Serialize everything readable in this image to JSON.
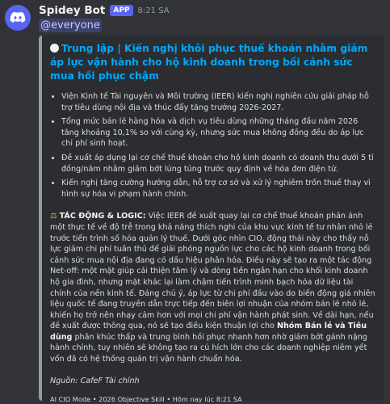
{
  "bot": {
    "name": "Spidey Bot",
    "badge": "APP",
    "timestamp": "8:21 SA",
    "mention": "@everyone"
  },
  "embed": {
    "accent_color": "#949ba4",
    "title": "Trung lập | Kiến nghị khôi phục thuế khoán nhằm giảm áp lực vận hành cho hộ kinh doanh trong bối cảnh sức mua hồi phục chậm",
    "bullets": [
      "Viện Kinh tế Tài nguyên và Môi trường (IEER) kiến nghị nghiên cứu giải pháp hỗ trợ tiêu dùng nội địa và thúc đẩy tăng trưởng 2026-2027.",
      "Tổng mức bán lẻ hàng hóa và dịch vụ tiêu dùng những tháng đầu năm 2026 tăng khoảng 10,1% so với cùng kỳ, nhưng sức mua không đồng đều do áp lực chi phí sinh hoạt.",
      "Đề xuất áp dụng lại cơ chế thuế khoán cho hộ kinh doanh có doanh thu dưới 5 tỉ đồng/năm nhằm giảm bớt lúng túng trước quy định về hóa đơn điện tử.",
      "Kiến nghị tăng cường hướng dẫn, hỗ trợ cơ sở và xử lý nghiêm trốn thuế thay vì hình sự hóa vi phạm hành chính."
    ],
    "impact_label": "TÁC ĐỘNG & LOGIC:",
    "impact_text_1": " Việc IEER đề xuất quay lại cơ chế thuế khoán phản ánh một thực tế về độ trễ trong khả năng thích nghi của khu vực kinh tế tư nhân nhỏ lẻ trước tiến trình số hóa quản lý thuế. Dưới góc nhìn CIO, động thái này cho thấy nỗ lực giảm chi phí tuân thủ để giải phóng nguồn lực cho các hộ kinh doanh trong bối cảnh sức mua nội địa đang có dấu hiệu phân hóa. Điều này sẽ tạo ra một tác động Net-off: một mặt giúp cải thiện tâm lý và dòng tiền ngắn hạn cho khối kinh doanh hộ gia đình, nhưng mặt khác lại làm chậm tiến trình minh bạch hóa dữ liệu tài chính của nền kinh tế. Đáng chú ý, áp lực từ chi phí đầu vào do biến động giá nhiên liệu quốc tế đang truyền dẫn trực tiếp đến biên lợi nhuận của nhóm bán lẻ nhỏ lẻ, khiến họ trở nên nhạy cảm hơn với mọi chi phí vận hành phát sinh. Về dài hạn, nếu đề xuất được thông qua, nó sẽ tạo điều kiện thuận lợi cho ",
    "impact_bold": "Nhóm Bán lẻ và Tiêu dùng",
    "impact_text_2": " phân khúc thấp và trung bình hồi phục nhanh hơn nhờ giảm bớt gánh nặng hành chính, tuy nhiên sẽ không tạo ra cú hích lớn cho các doanh nghiệp niêm yết vốn đã có hệ thống quản trị vận hành chuẩn hóa.",
    "source": "Nguồn: CafeF Tài chính",
    "footer": "AI CIO Mode • 2026 Objective Skill • Hôm nay lúc 8:21 SA"
  },
  "icons": {
    "avatar": "discord-logo-icon",
    "title_marker": "white-circle-icon",
    "impact_marker": "balance-scale-icon"
  }
}
